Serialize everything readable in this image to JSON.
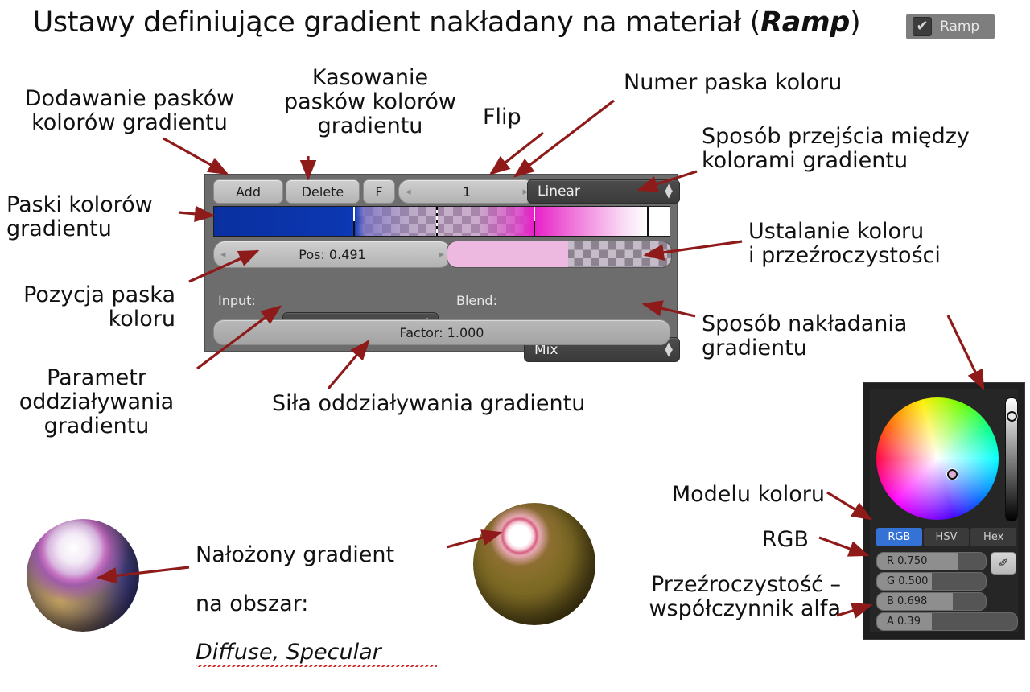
{
  "title": {
    "prefix": "Ustawy definiujące gradient nakładany na materiał (",
    "emphasis": "Ramp",
    "suffix": ")"
  },
  "header_toggle": {
    "label": "Ramp",
    "checkmark": "✔",
    "checked": true,
    "icon": "checkbox-checked-icon"
  },
  "ramp_panel": {
    "add_label": "Add",
    "delete_label": "Delete",
    "flip_label": "F",
    "index_value": "1",
    "index_prev": "◂",
    "index_next": "▸",
    "interpolation_value": "Linear",
    "spin_up": "▲",
    "spin_down": "▼",
    "position_label": "Pos: 0.491",
    "position_prev": "◂",
    "position_next": "▸",
    "input_label": "Input:",
    "input_value": "Shader",
    "blend_label": "Blend:",
    "blend_value": "Mix",
    "factor_label": "Factor: 1.000"
  },
  "color_picker": {
    "modes": [
      {
        "label": "RGB",
        "active": true
      },
      {
        "label": "HSV",
        "active": false
      },
      {
        "label": "Hex",
        "active": false
      }
    ],
    "channels": [
      {
        "label": "R 0.750",
        "fill_pct": 75
      },
      {
        "label": "G 0.500",
        "fill_pct": 50
      },
      {
        "label": "B 0.698",
        "fill_pct": 69.8
      },
      {
        "label": "A 0.39",
        "fill_pct": 39
      }
    ],
    "eyedropper_icon": "✐",
    "eyedropper_name": "eyedropper-icon"
  },
  "annotations": {
    "add_stripes": "Dodawanie pasków\nkolorów gradientu",
    "delete_stripes": "Kasowanie\npasków kolorów\ngradientu",
    "flip": "Flip",
    "stripe_number": "Numer paska koloru",
    "interpolation": "Sposób przejścia między\nkolorami gradientu",
    "color_stripes": "Paski kolorów\ngradientu",
    "set_color_alpha": "Ustalanie koloru\ni przeźroczystości",
    "stripe_position": "Pozycja paska\nkoloru",
    "blend_method": "Sposób nakładania\ngradientu",
    "influence_param": "Parametr\noddziaływania\ngradientu",
    "influence_strength": "Siła oddziaływania gradientu",
    "applied_gradient_line1": "Nałożony gradient",
    "applied_gradient_line2": "na obszar:",
    "applied_gradient_areas": "Diffuse, Specular",
    "color_model": "Modelu koloru",
    "rgb": "RGB",
    "alpha": "Przeźroczystość –\nwspółczynnik alfa"
  },
  "colors": {
    "arrow": "#8f1a1a",
    "panel_bg": "#6d6d6d",
    "picker_bg": "#1f1f1f",
    "accent_blue": "#3572d6",
    "ramp_blue": "#0c37b2",
    "ramp_magenta": "#e81ec8",
    "swatch_pink": "#edb9e0"
  }
}
